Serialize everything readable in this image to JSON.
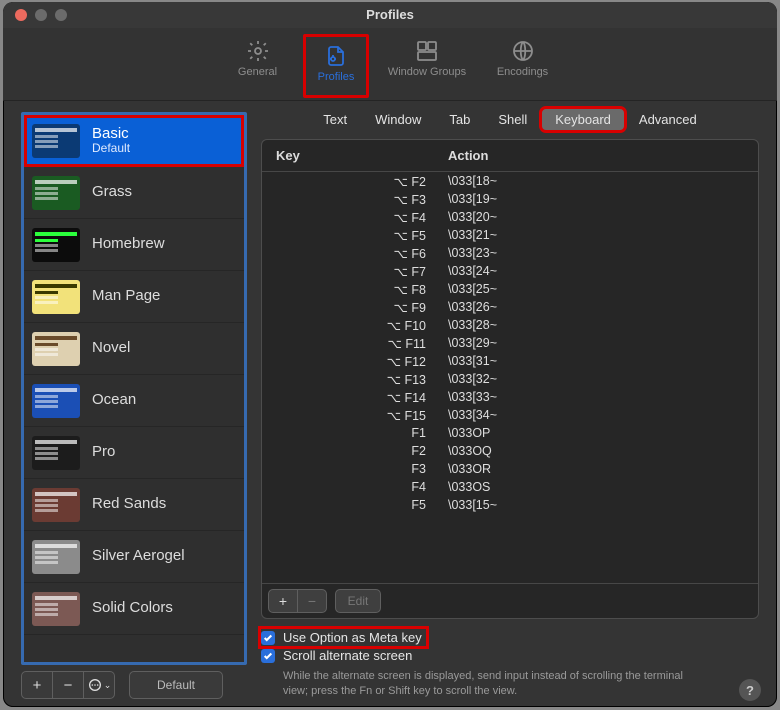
{
  "window": {
    "title": "Profiles"
  },
  "toolbar": {
    "items": [
      {
        "label": "General"
      },
      {
        "label": "Profiles"
      },
      {
        "label": "Window Groups"
      },
      {
        "label": "Encodings"
      }
    ]
  },
  "sidebar": {
    "items": [
      {
        "name": "Basic",
        "sub": "Default",
        "thumb": "basic",
        "selected": true,
        "boxed": true
      },
      {
        "name": "Grass",
        "thumb": "grass"
      },
      {
        "name": "Homebrew",
        "thumb": "homebrew"
      },
      {
        "name": "Man Page",
        "thumb": "manpage"
      },
      {
        "name": "Novel",
        "thumb": "novel"
      },
      {
        "name": "Ocean",
        "thumb": "ocean"
      },
      {
        "name": "Pro",
        "thumb": "pro"
      },
      {
        "name": "Red Sands",
        "thumb": "redsands"
      },
      {
        "name": "Silver Aerogel",
        "thumb": "silver"
      },
      {
        "name": "Solid Colors",
        "thumb": "solid"
      }
    ],
    "default_button": "Default"
  },
  "segments": {
    "items": [
      "Text",
      "Window",
      "Tab",
      "Shell",
      "Keyboard",
      "Advanced"
    ],
    "selected": "Keyboard"
  },
  "keytable": {
    "headers": {
      "key": "Key",
      "action": "Action"
    },
    "rows": [
      {
        "key": "⌥ F2",
        "action": "\\033[18~"
      },
      {
        "key": "⌥ F3",
        "action": "\\033[19~"
      },
      {
        "key": "⌥ F4",
        "action": "\\033[20~"
      },
      {
        "key": "⌥ F5",
        "action": "\\033[21~"
      },
      {
        "key": "⌥ F6",
        "action": "\\033[23~"
      },
      {
        "key": "⌥ F7",
        "action": "\\033[24~"
      },
      {
        "key": "⌥ F8",
        "action": "\\033[25~"
      },
      {
        "key": "⌥ F9",
        "action": "\\033[26~"
      },
      {
        "key": "⌥ F10",
        "action": "\\033[28~"
      },
      {
        "key": "⌥ F11",
        "action": "\\033[29~"
      },
      {
        "key": "⌥ F12",
        "action": "\\033[31~"
      },
      {
        "key": "⌥ F13",
        "action": "\\033[32~"
      },
      {
        "key": "⌥ F14",
        "action": "\\033[33~"
      },
      {
        "key": "⌥ F15",
        "action": "\\033[34~"
      },
      {
        "key": "F1",
        "action": "\\033OP"
      },
      {
        "key": "F2",
        "action": "\\033OQ"
      },
      {
        "key": "F3",
        "action": "\\033OR"
      },
      {
        "key": "F4",
        "action": "\\033OS"
      },
      {
        "key": "F5",
        "action": "\\033[15~"
      }
    ],
    "edit_label": "Edit"
  },
  "options": {
    "meta": "Use Option as Meta key",
    "scroll": "Scroll alternate screen",
    "hint": "While the alternate screen is displayed, send input instead of scrolling the terminal view; press the Fn or Shift key to scroll the view."
  }
}
